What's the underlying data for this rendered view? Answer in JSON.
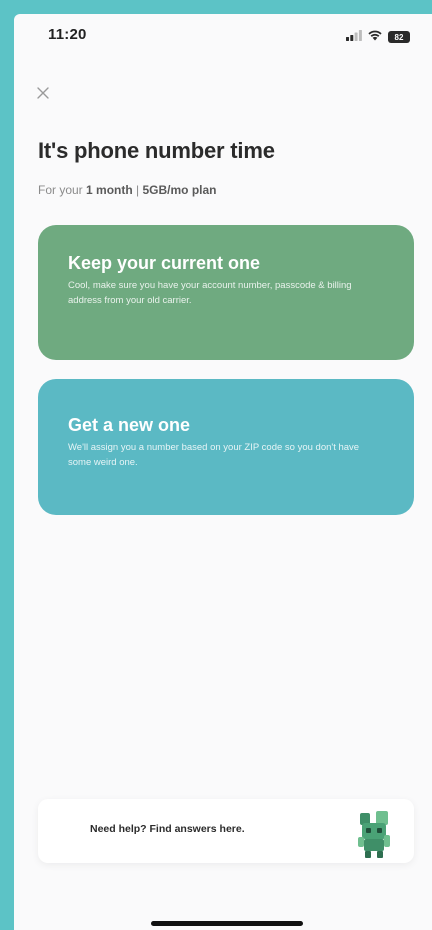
{
  "status_bar": {
    "time": "11:20",
    "battery": "82",
    "icons": [
      "signal-icon",
      "wifi-icon",
      "battery-icon"
    ]
  },
  "header": {
    "close_icon": "close-icon",
    "title": "It's phone number time",
    "subtitle_prefix": "For your ",
    "plan_duration": "1 month",
    "separator": " | ",
    "plan_data": "5GB/mo plan"
  },
  "options": [
    {
      "title": "Keep your current one",
      "description": "Cool, make sure you have your account number, passcode & billing address from your old carrier.",
      "color": "#6faa80"
    },
    {
      "title": "Get a new one",
      "description": "We'll assign you a number based on your ZIP code so you don't have some weird one.",
      "color": "#5bb9c4"
    }
  ],
  "help": {
    "text": "Need help? Find answers here.",
    "mascot_icon": "mascot-icon"
  },
  "colors": {
    "background": "#5cc3c6",
    "keep_card": "#6faa80",
    "new_card": "#5bb9c4"
  }
}
